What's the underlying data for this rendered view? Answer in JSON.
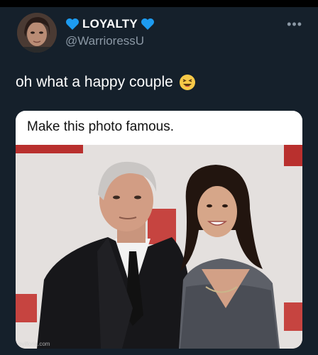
{
  "user": {
    "display_name": "LOYALTY",
    "handle": "@WarrioressU",
    "avatar_icon": "profile-photo",
    "badge_icon": "blue-heart-icon"
  },
  "tweet": {
    "text": "oh what a happy couple",
    "emoji": "grinning-squinting-face"
  },
  "media": {
    "caption": "Make this photo famous.",
    "watermark": "ovilloria.com"
  },
  "more_label": "•••",
  "colors": {
    "background": "#15202b",
    "secondary_text": "#8b98a5",
    "heart": "#1d9bf0"
  }
}
